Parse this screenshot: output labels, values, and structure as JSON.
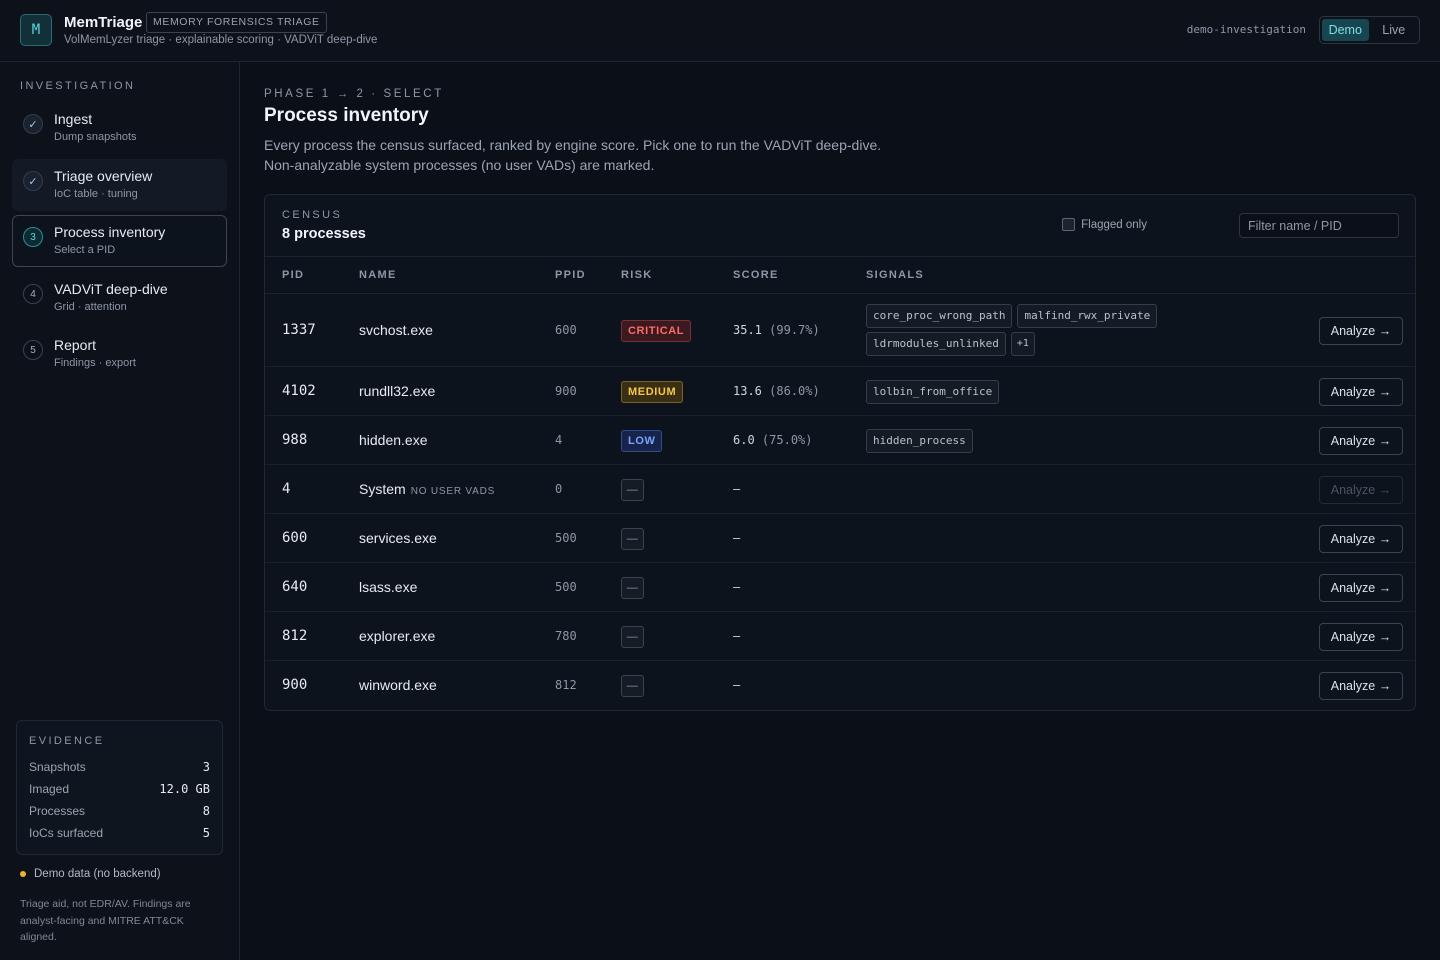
{
  "header": {
    "logo_letter": "M",
    "app_name": "MemTriage",
    "badge": "MEMORY FORENSICS TRIAGE",
    "subtitle": "VolMemLyzer triage · explainable scoring · VADViT deep-dive",
    "investigation": "demo-investigation",
    "modes": [
      "Demo",
      "Live"
    ],
    "active_mode": "Demo"
  },
  "sidebar": {
    "heading": "INVESTIGATION",
    "steps": [
      {
        "num": "✓",
        "title": "Ingest",
        "sub": "Dump snapshots",
        "state": "done"
      },
      {
        "num": "✓",
        "title": "Triage overview",
        "sub": "IoC table · tuning",
        "state": "done"
      },
      {
        "num": "3",
        "title": "Process inventory",
        "sub": "Select a PID",
        "state": "current"
      },
      {
        "num": "4",
        "title": "VADViT deep-dive",
        "sub": "Grid · attention",
        "state": "todo"
      },
      {
        "num": "5",
        "title": "Report",
        "sub": "Findings · export",
        "state": "todo"
      }
    ],
    "evidence": {
      "heading": "EVIDENCE",
      "rows": [
        {
          "label": "Snapshots",
          "value": "3"
        },
        {
          "label": "Imaged",
          "value": "12.0 GB"
        },
        {
          "label": "Processes",
          "value": "8"
        },
        {
          "label": "IoCs surfaced",
          "value": "5"
        }
      ]
    },
    "demo_note": "Demo data (no backend)",
    "disclaimer": "Triage aid, not EDR/AV. Findings are analyst-facing and MITRE ATT&CK aligned."
  },
  "main": {
    "phase": "PHASE 1 → 2 · SELECT",
    "title": "Process inventory",
    "description_line1": "Every process the census surfaced, ranked by engine score. Pick one to run the VADViT deep-dive.",
    "description_line2": "Non-analyzable system processes (no user VADs) are marked.",
    "census": {
      "label": "CENSUS",
      "count": "8 processes",
      "flagged_only": "Flagged only",
      "filter_placeholder": "Filter name / PID",
      "filter_value": ""
    },
    "columns": [
      "PID",
      "NAME",
      "PPID",
      "RISK",
      "SCORE",
      "SIGNALS"
    ],
    "analyze_label": "Analyze →",
    "rows": [
      {
        "pid": "1337",
        "name": "svchost.exe",
        "tag": "",
        "ppid": "600",
        "risk": "CRITICAL",
        "risk_class": "critical",
        "score": "35.1",
        "pct": "(99.7%)",
        "signals": [
          "core_proc_wrong_path",
          "malfind_rwx_private",
          "ldrmodules_unlinked",
          "+1"
        ],
        "analyzable": true
      },
      {
        "pid": "4102",
        "name": "rundll32.exe",
        "tag": "",
        "ppid": "900",
        "risk": "MEDIUM",
        "risk_class": "medium",
        "score": "13.6",
        "pct": "(86.0%)",
        "signals": [
          "lolbin_from_office"
        ],
        "analyzable": true
      },
      {
        "pid": "988",
        "name": "hidden.exe",
        "tag": "",
        "ppid": "4",
        "risk": "LOW",
        "risk_class": "low",
        "score": "6.0",
        "pct": "(75.0%)",
        "signals": [
          "hidden_process"
        ],
        "analyzable": true
      },
      {
        "pid": "4",
        "name": "System",
        "tag": "NO USER VADS",
        "ppid": "0",
        "risk": "—",
        "risk_class": "none",
        "score": "—",
        "pct": "",
        "signals": [],
        "analyzable": false
      },
      {
        "pid": "600",
        "name": "services.exe",
        "tag": "",
        "ppid": "500",
        "risk": "—",
        "risk_class": "none",
        "score": "—",
        "pct": "",
        "signals": [],
        "analyzable": true
      },
      {
        "pid": "640",
        "name": "lsass.exe",
        "tag": "",
        "ppid": "500",
        "risk": "—",
        "risk_class": "none",
        "score": "—",
        "pct": "",
        "signals": [],
        "analyzable": true
      },
      {
        "pid": "812",
        "name": "explorer.exe",
        "tag": "",
        "ppid": "780",
        "risk": "—",
        "risk_class": "none",
        "score": "—",
        "pct": "",
        "signals": [],
        "analyzable": true
      },
      {
        "pid": "900",
        "name": "winword.exe",
        "tag": "",
        "ppid": "812",
        "risk": "—",
        "risk_class": "none",
        "score": "—",
        "pct": "",
        "signals": [],
        "analyzable": true
      }
    ]
  }
}
